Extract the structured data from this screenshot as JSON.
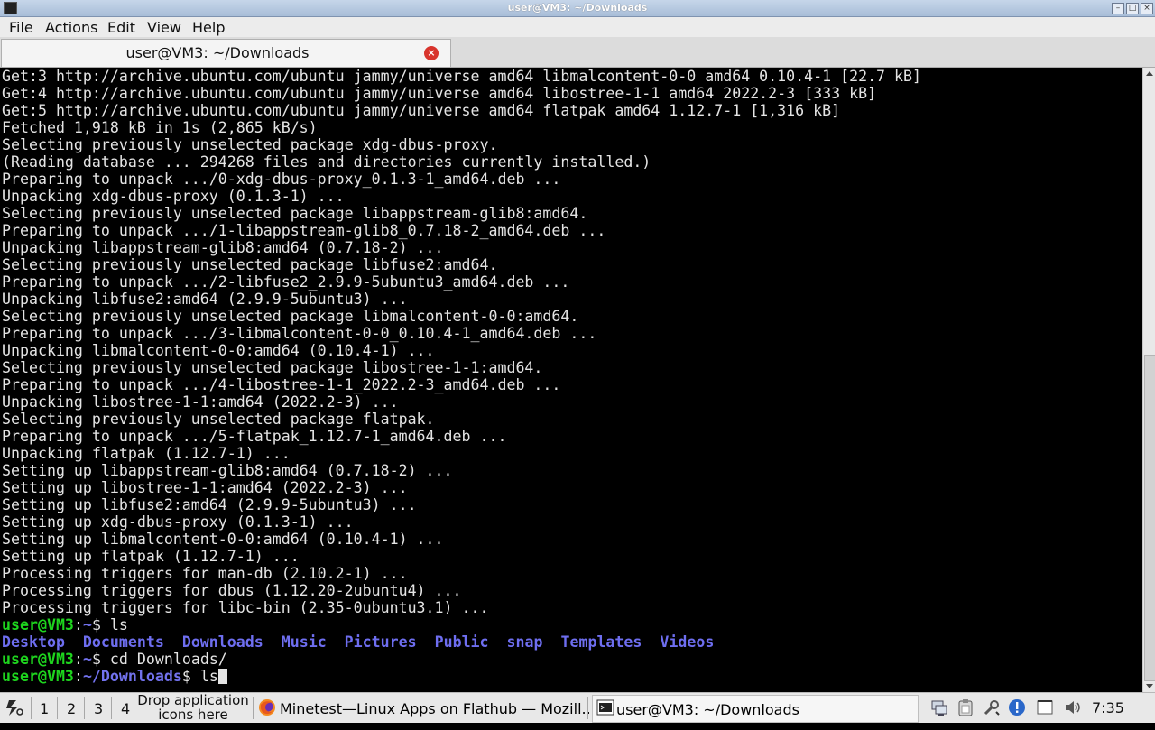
{
  "window": {
    "title": "user@VM3: ~/Downloads"
  },
  "menu": [
    "File",
    "Actions",
    "Edit",
    "View",
    "Help"
  ],
  "tab": {
    "label": "user@VM3: ~/Downloads"
  },
  "terminal": {
    "output_lines": [
      "Get:3 http://archive.ubuntu.com/ubuntu jammy/universe amd64 libmalcontent-0-0 amd64 0.10.4-1 [22.7 kB]",
      "Get:4 http://archive.ubuntu.com/ubuntu jammy/universe amd64 libostree-1-1 amd64 2022.2-3 [333 kB]",
      "Get:5 http://archive.ubuntu.com/ubuntu jammy/universe amd64 flatpak amd64 1.12.7-1 [1,316 kB]",
      "Fetched 1,918 kB in 1s (2,865 kB/s)",
      "Selecting previously unselected package xdg-dbus-proxy.",
      "(Reading database ... 294268 files and directories currently installed.)",
      "Preparing to unpack .../0-xdg-dbus-proxy_0.1.3-1_amd64.deb ...",
      "Unpacking xdg-dbus-proxy (0.1.3-1) ...",
      "Selecting previously unselected package libappstream-glib8:amd64.",
      "Preparing to unpack .../1-libappstream-glib8_0.7.18-2_amd64.deb ...",
      "Unpacking libappstream-glib8:amd64 (0.7.18-2) ...",
      "Selecting previously unselected package libfuse2:amd64.",
      "Preparing to unpack .../2-libfuse2_2.9.9-5ubuntu3_amd64.deb ...",
      "Unpacking libfuse2:amd64 (2.9.9-5ubuntu3) ...",
      "Selecting previously unselected package libmalcontent-0-0:amd64.",
      "Preparing to unpack .../3-libmalcontent-0-0_0.10.4-1_amd64.deb ...",
      "Unpacking libmalcontent-0-0:amd64 (0.10.4-1) ...",
      "Selecting previously unselected package libostree-1-1:amd64.",
      "Preparing to unpack .../4-libostree-1-1_2022.2-3_amd64.deb ...",
      "Unpacking libostree-1-1:amd64 (2022.2-3) ...",
      "Selecting previously unselected package flatpak.",
      "Preparing to unpack .../5-flatpak_1.12.7-1_amd64.deb ...",
      "Unpacking flatpak (1.12.7-1) ...",
      "Setting up libappstream-glib8:amd64 (0.7.18-2) ...",
      "Setting up libostree-1-1:amd64 (2022.2-3) ...",
      "Setting up libfuse2:amd64 (2.9.9-5ubuntu3) ...",
      "Setting up xdg-dbus-proxy (0.1.3-1) ...",
      "Setting up libmalcontent-0-0:amd64 (0.10.4-1) ...",
      "Setting up flatpak (1.12.7-1) ...",
      "Processing triggers for man-db (2.10.2-1) ...",
      "Processing triggers for dbus (1.12.20-2ubuntu4) ...",
      "Processing triggers for libc-bin (2.35-0ubuntu3.1) ..."
    ],
    "prompt1": {
      "user": "user@VM3",
      "sep": ":",
      "path": "~",
      "sign": "$ ",
      "cmd": "ls"
    },
    "ls_dirs": [
      "Desktop",
      "Documents",
      "Downloads",
      "Music",
      "Pictures",
      "Public",
      "snap",
      "Templates",
      "Videos"
    ],
    "prompt2": {
      "user": "user@VM3",
      "sep": ":",
      "path": "~",
      "sign": "$ ",
      "cmd": "cd Downloads/"
    },
    "prompt3": {
      "user": "user@VM3",
      "sep": ":",
      "path": "~/Downloads",
      "sign": "$ ",
      "cmd": "ls"
    }
  },
  "taskbar": {
    "desktops": [
      "1",
      "2",
      "3",
      "4"
    ],
    "drop_hint": [
      "Drop application",
      "icons here"
    ],
    "tasks": [
      {
        "label": "Minetest—Linux Apps on Flathub — Mozill...",
        "icon": "firefox-icon"
      },
      {
        "label": "user@VM3: ~/Downloads",
        "icon": "terminal-icon"
      }
    ],
    "clock": "7:35"
  }
}
